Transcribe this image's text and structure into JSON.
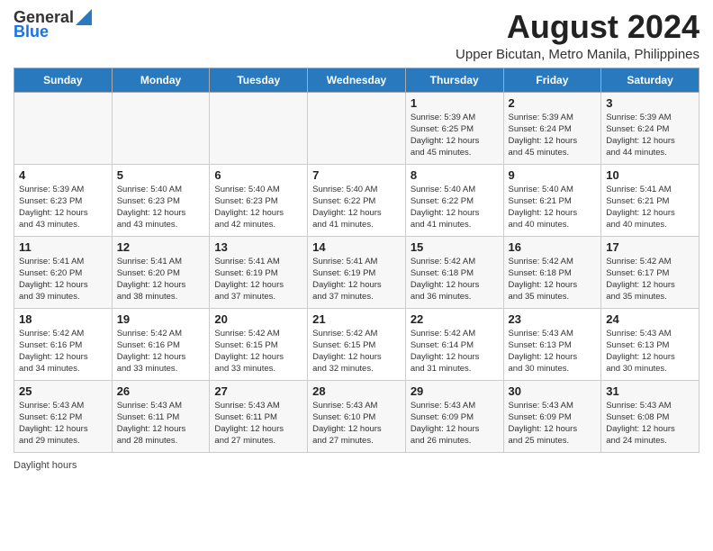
{
  "header": {
    "logo_general": "General",
    "logo_blue": "Blue",
    "main_title": "August 2024",
    "subtitle": "Upper Bicutan, Metro Manila, Philippines"
  },
  "columns": [
    "Sunday",
    "Monday",
    "Tuesday",
    "Wednesday",
    "Thursday",
    "Friday",
    "Saturday"
  ],
  "weeks": [
    {
      "days": [
        {
          "num": "",
          "info": ""
        },
        {
          "num": "",
          "info": ""
        },
        {
          "num": "",
          "info": ""
        },
        {
          "num": "",
          "info": ""
        },
        {
          "num": "1",
          "info": "Sunrise: 5:39 AM\nSunset: 6:25 PM\nDaylight: 12 hours\nand 45 minutes."
        },
        {
          "num": "2",
          "info": "Sunrise: 5:39 AM\nSunset: 6:24 PM\nDaylight: 12 hours\nand 45 minutes."
        },
        {
          "num": "3",
          "info": "Sunrise: 5:39 AM\nSunset: 6:24 PM\nDaylight: 12 hours\nand 44 minutes."
        }
      ]
    },
    {
      "days": [
        {
          "num": "4",
          "info": "Sunrise: 5:39 AM\nSunset: 6:23 PM\nDaylight: 12 hours\nand 43 minutes."
        },
        {
          "num": "5",
          "info": "Sunrise: 5:40 AM\nSunset: 6:23 PM\nDaylight: 12 hours\nand 43 minutes."
        },
        {
          "num": "6",
          "info": "Sunrise: 5:40 AM\nSunset: 6:23 PM\nDaylight: 12 hours\nand 42 minutes."
        },
        {
          "num": "7",
          "info": "Sunrise: 5:40 AM\nSunset: 6:22 PM\nDaylight: 12 hours\nand 41 minutes."
        },
        {
          "num": "8",
          "info": "Sunrise: 5:40 AM\nSunset: 6:22 PM\nDaylight: 12 hours\nand 41 minutes."
        },
        {
          "num": "9",
          "info": "Sunrise: 5:40 AM\nSunset: 6:21 PM\nDaylight: 12 hours\nand 40 minutes."
        },
        {
          "num": "10",
          "info": "Sunrise: 5:41 AM\nSunset: 6:21 PM\nDaylight: 12 hours\nand 40 minutes."
        }
      ]
    },
    {
      "days": [
        {
          "num": "11",
          "info": "Sunrise: 5:41 AM\nSunset: 6:20 PM\nDaylight: 12 hours\nand 39 minutes."
        },
        {
          "num": "12",
          "info": "Sunrise: 5:41 AM\nSunset: 6:20 PM\nDaylight: 12 hours\nand 38 minutes."
        },
        {
          "num": "13",
          "info": "Sunrise: 5:41 AM\nSunset: 6:19 PM\nDaylight: 12 hours\nand 37 minutes."
        },
        {
          "num": "14",
          "info": "Sunrise: 5:41 AM\nSunset: 6:19 PM\nDaylight: 12 hours\nand 37 minutes."
        },
        {
          "num": "15",
          "info": "Sunrise: 5:42 AM\nSunset: 6:18 PM\nDaylight: 12 hours\nand 36 minutes."
        },
        {
          "num": "16",
          "info": "Sunrise: 5:42 AM\nSunset: 6:18 PM\nDaylight: 12 hours\nand 35 minutes."
        },
        {
          "num": "17",
          "info": "Sunrise: 5:42 AM\nSunset: 6:17 PM\nDaylight: 12 hours\nand 35 minutes."
        }
      ]
    },
    {
      "days": [
        {
          "num": "18",
          "info": "Sunrise: 5:42 AM\nSunset: 6:16 PM\nDaylight: 12 hours\nand 34 minutes."
        },
        {
          "num": "19",
          "info": "Sunrise: 5:42 AM\nSunset: 6:16 PM\nDaylight: 12 hours\nand 33 minutes."
        },
        {
          "num": "20",
          "info": "Sunrise: 5:42 AM\nSunset: 6:15 PM\nDaylight: 12 hours\nand 33 minutes."
        },
        {
          "num": "21",
          "info": "Sunrise: 5:42 AM\nSunset: 6:15 PM\nDaylight: 12 hours\nand 32 minutes."
        },
        {
          "num": "22",
          "info": "Sunrise: 5:42 AM\nSunset: 6:14 PM\nDaylight: 12 hours\nand 31 minutes."
        },
        {
          "num": "23",
          "info": "Sunrise: 5:43 AM\nSunset: 6:13 PM\nDaylight: 12 hours\nand 30 minutes."
        },
        {
          "num": "24",
          "info": "Sunrise: 5:43 AM\nSunset: 6:13 PM\nDaylight: 12 hours\nand 30 minutes."
        }
      ]
    },
    {
      "days": [
        {
          "num": "25",
          "info": "Sunrise: 5:43 AM\nSunset: 6:12 PM\nDaylight: 12 hours\nand 29 minutes."
        },
        {
          "num": "26",
          "info": "Sunrise: 5:43 AM\nSunset: 6:11 PM\nDaylight: 12 hours\nand 28 minutes."
        },
        {
          "num": "27",
          "info": "Sunrise: 5:43 AM\nSunset: 6:11 PM\nDaylight: 12 hours\nand 27 minutes."
        },
        {
          "num": "28",
          "info": "Sunrise: 5:43 AM\nSunset: 6:10 PM\nDaylight: 12 hours\nand 27 minutes."
        },
        {
          "num": "29",
          "info": "Sunrise: 5:43 AM\nSunset: 6:09 PM\nDaylight: 12 hours\nand 26 minutes."
        },
        {
          "num": "30",
          "info": "Sunrise: 5:43 AM\nSunset: 6:09 PM\nDaylight: 12 hours\nand 25 minutes."
        },
        {
          "num": "31",
          "info": "Sunrise: 5:43 AM\nSunset: 6:08 PM\nDaylight: 12 hours\nand 24 minutes."
        }
      ]
    }
  ],
  "footer": {
    "daylight_hours_label": "Daylight hours"
  }
}
